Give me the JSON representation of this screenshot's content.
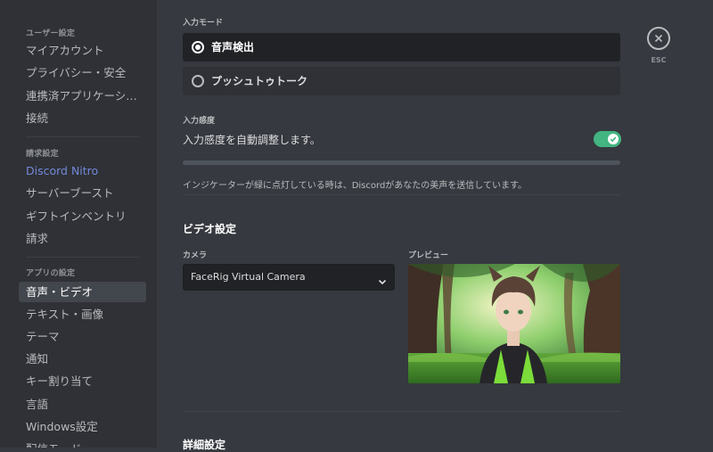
{
  "sidebar": {
    "user_header": "ユーザー設定",
    "user_items": [
      "マイアカウント",
      "プライバシー・安全",
      "連携済アプリケーション",
      "接続"
    ],
    "billing_header": "請求設定",
    "billing_items": [
      "Discord Nitro",
      "サーバーブースト",
      "ギフトインベントリ",
      "請求"
    ],
    "app_header": "アプリの設定",
    "app_items": [
      "音声・ビデオ",
      "テキスト・画像",
      "テーマ",
      "通知",
      "キー割り当て",
      "言語",
      "Windows設定",
      "配信モード"
    ]
  },
  "input_mode": {
    "label": "入力モード",
    "options": [
      "音声検出",
      "プッシュトゥトーク"
    ],
    "selected": "音声検出"
  },
  "sensitivity": {
    "label": "入力感度",
    "auto_text": "入力感度を自動調整します。",
    "auto_enabled": true,
    "note": "インジケーターが緑に点灯している時は、Discordがあなたの美声を送信しています。"
  },
  "video": {
    "title": "ビデオ設定",
    "camera_label": "カメラ",
    "camera_value": "FaceRig Virtual Camera",
    "preview_label": "プレビュー"
  },
  "advanced": {
    "title": "詳細設定"
  },
  "close": {
    "esc_label": "ESC"
  },
  "colors": {
    "accent_green": "#43b581",
    "nitro_blue": "#7289da",
    "background": "#36393f",
    "sidebar_bg": "#2f3136"
  }
}
